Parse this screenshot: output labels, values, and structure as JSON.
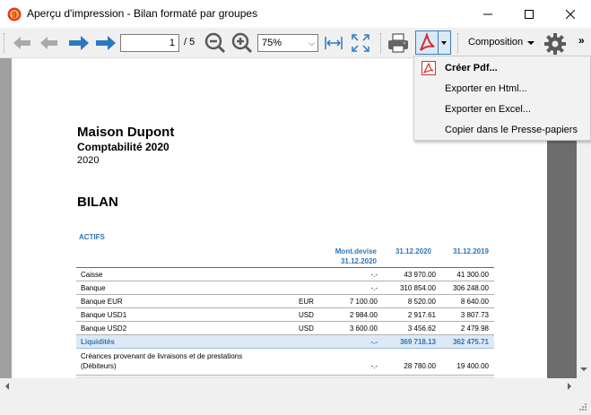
{
  "window": {
    "title": "Aperçu d'impression - Bilan formaté par groupes",
    "icon": "app-logo-icon"
  },
  "toolbar": {
    "page_current": "1",
    "page_total": "/ 5",
    "zoom_value": "75%",
    "composition_label": "Composition",
    "more_label": "»"
  },
  "menu": {
    "items": [
      {
        "label": "Créer Pdf...",
        "icon": "pdf-icon"
      },
      {
        "label": "Exporter en Html..."
      },
      {
        "label": "Exporter en Excel..."
      },
      {
        "label": "Copier dans le Presse-papiers"
      }
    ]
  },
  "report": {
    "company": "Maison Dupont",
    "subtitle": "Comptabilité 2020",
    "year": "2020",
    "section_title": "BILAN",
    "group_title": "ACTIFS",
    "headers": {
      "mont_devise_line1": "Mont.devise",
      "mont_devise_line2": "31.12.2020",
      "col_2020": "31.12.2020",
      "col_2019": "31.12.2019"
    },
    "rows": [
      {
        "label": "Caisse",
        "cur": "",
        "amt": "",
        "mont": "-.-",
        "v2020": "43 970.00",
        "v2019": "41 300.00"
      },
      {
        "label": "Banque",
        "cur": "",
        "amt": "",
        "mont": "-.-",
        "v2020": "310 854.00",
        "v2019": "306 248.00"
      },
      {
        "label": "Banque EUR",
        "cur": "EUR",
        "amt": "7 100.00",
        "mont": "",
        "v2020": "8 520.00",
        "v2019": "8 640.00"
      },
      {
        "label": "Banque USD1",
        "cur": "USD",
        "amt": "2 984.00",
        "mont": "",
        "v2020": "2 917.61",
        "v2019": "3 807.73"
      },
      {
        "label": "Banque USD2",
        "cur": "USD",
        "amt": "3 600.00",
        "mont": "",
        "v2020": "3 456.62",
        "v2019": "2 479.98"
      }
    ],
    "group_row": {
      "label": "Liquidités",
      "mont": "-.-",
      "v2020": "369 718.13",
      "v2019": "362 475.71"
    },
    "row_multi": {
      "line1": "Créances provenant de livraisons et de prestations",
      "line2": "(Débiteurs)",
      "mont": "-.-",
      "v2020": "28 780.00",
      "v2019": "19 400.00"
    }
  },
  "colors": {
    "accent": "#2e75b6",
    "group_bg": "#dce9f5",
    "pdf_red": "#d32f2f",
    "nav_arrow_active": "#2b79c2"
  }
}
